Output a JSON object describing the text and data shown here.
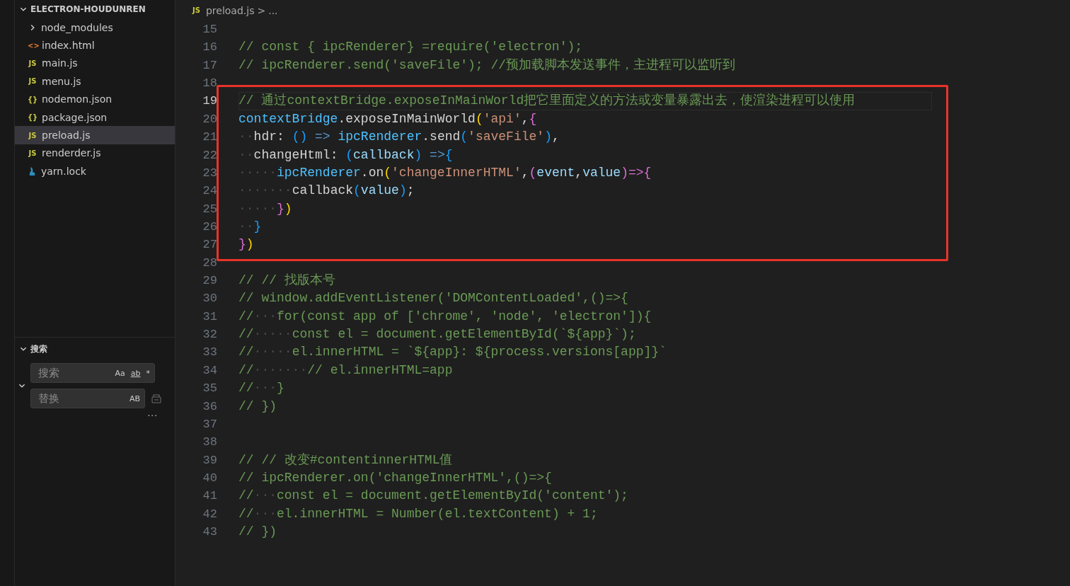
{
  "explorer": {
    "root": {
      "label": "ELECTRON-HOUDUNREN",
      "expanded": true
    },
    "items": [
      {
        "kind": "folder",
        "name": "node_modules",
        "selected": false
      },
      {
        "kind": "html",
        "icon": "<>",
        "name": "index.html",
        "selected": false
      },
      {
        "kind": "js",
        "icon": "JS",
        "name": "main.js",
        "selected": false
      },
      {
        "kind": "js",
        "icon": "JS",
        "name": "menu.js",
        "selected": false
      },
      {
        "kind": "json",
        "icon": "{}",
        "name": "nodemon.json",
        "selected": false
      },
      {
        "kind": "json",
        "icon": "{}",
        "name": "package.json",
        "selected": false
      },
      {
        "kind": "js",
        "icon": "JS",
        "name": "preload.js",
        "selected": true
      },
      {
        "kind": "js",
        "icon": "JS",
        "name": "renderder.js",
        "selected": false
      },
      {
        "kind": "yarn",
        "name": "yarn.lock",
        "selected": false
      }
    ]
  },
  "search": {
    "title": "搜索",
    "expanded": true,
    "replace_expanded": true,
    "find": {
      "placeholder": "搜索",
      "options": [
        "Aa",
        "ab",
        "*"
      ]
    },
    "replace": {
      "placeholder": "替换",
      "options": [
        "AB"
      ]
    },
    "more": "···"
  },
  "breadcrumb": {
    "icon": "JS",
    "file": "preload.js",
    "separator": ">",
    "rest": "..."
  },
  "code": {
    "blocks": [
      {
        "boxed": false,
        "lines": [
          {
            "number": "15",
            "current": false
          },
          {
            "number": "16",
            "current": false,
            "tokens": [
              {
                "kind": "comment",
                "text": "// const { ipcRenderer} =require('electron');"
              }
            ]
          },
          {
            "number": "17",
            "current": false,
            "tokens": [
              {
                "kind": "comment",
                "text": "// ipcRenderer.send('saveFile'); //预加载脚本发送事件，主进程可以监听到"
              }
            ]
          },
          {
            "number": "18",
            "current": false
          }
        ]
      },
      {
        "boxed": true,
        "lines": [
          {
            "number": "19",
            "current": true,
            "tokens": [
              {
                "kind": "comment",
                "text": "// 通过contextBridge.exposeInMainWorld把它里面定义的方法或变量暴露出去，使渲染进程可以使用"
              }
            ]
          },
          {
            "number": "20",
            "current": false,
            "tokens": [
              {
                "kind": "global",
                "text": "contextBridge"
              },
              {
                "kind": "plain",
                "text": ".exposeInMainWorld"
              },
              {
                "kind": "bracket1",
                "text": "("
              },
              {
                "kind": "string",
                "text": "'api'"
              },
              {
                "kind": "plain",
                "text": ","
              },
              {
                "kind": "bracket2",
                "text": "{"
              }
            ]
          },
          {
            "number": "21",
            "current": false,
            "tokens": [
              {
                "kind": "whitespace",
                "text": "··"
              },
              {
                "kind": "plain",
                "text": "hdr: "
              },
              {
                "kind": "bracket3",
                "text": "()"
              },
              {
                "kind": "keyword",
                "text": " => "
              },
              {
                "kind": "global",
                "text": "ipcRenderer"
              },
              {
                "kind": "plain",
                "text": ".send"
              },
              {
                "kind": "bracket3",
                "text": "("
              },
              {
                "kind": "string",
                "text": "'saveFile'"
              },
              {
                "kind": "bracket3",
                "text": ")"
              },
              {
                "kind": "plain",
                "text": ","
              }
            ]
          },
          {
            "number": "22",
            "current": false,
            "tokens": [
              {
                "kind": "whitespace",
                "text": "··"
              },
              {
                "kind": "plain",
                "text": "changeHtml: "
              },
              {
                "kind": "bracket3",
                "text": "("
              },
              {
                "kind": "variable",
                "text": "callback"
              },
              {
                "kind": "bracket3",
                "text": ")"
              },
              {
                "kind": "keyword",
                "text": " =>"
              },
              {
                "kind": "bracket3",
                "text": "{"
              }
            ]
          },
          {
            "number": "23",
            "current": false,
            "tokens": [
              {
                "kind": "whitespace",
                "text": "·····"
              },
              {
                "kind": "global",
                "text": "ipcRenderer"
              },
              {
                "kind": "plain",
                "text": ".on"
              },
              {
                "kind": "bracket1",
                "text": "("
              },
              {
                "kind": "string",
                "text": "'changeInnerHTML'"
              },
              {
                "kind": "plain",
                "text": ","
              },
              {
                "kind": "bracket2",
                "text": "("
              },
              {
                "kind": "variable",
                "text": "event"
              },
              {
                "kind": "plain",
                "text": ","
              },
              {
                "kind": "variable",
                "text": "value"
              },
              {
                "kind": "bracket2",
                "text": ")"
              },
              {
                "kind": "bracket2",
                "text": "=>{"
              }
            ]
          },
          {
            "number": "24",
            "current": false,
            "tokens": [
              {
                "kind": "whitespace",
                "text": "·······"
              },
              {
                "kind": "plain",
                "text": "callback"
              },
              {
                "kind": "bracket3",
                "text": "("
              },
              {
                "kind": "variable",
                "text": "value"
              },
              {
                "kind": "bracket3",
                "text": ")"
              },
              {
                "kind": "plain",
                "text": ";"
              }
            ]
          },
          {
            "number": "25",
            "current": false,
            "tokens": [
              {
                "kind": "whitespace",
                "text": "·····"
              },
              {
                "kind": "bracket2",
                "text": "}"
              },
              {
                "kind": "bracket1",
                "text": ")"
              }
            ]
          },
          {
            "number": "26",
            "current": false,
            "tokens": [
              {
                "kind": "whitespace",
                "text": "··"
              },
              {
                "kind": "bracket3",
                "text": "}"
              }
            ]
          },
          {
            "number": "27",
            "current": false,
            "tokens": [
              {
                "kind": "bracket2",
                "text": "}"
              },
              {
                "kind": "bracket1",
                "text": ")"
              }
            ]
          }
        ]
      },
      {
        "boxed": false,
        "lines": [
          {
            "number": "28",
            "current": false
          },
          {
            "number": "29",
            "current": false,
            "tokens": [
              {
                "kind": "comment",
                "text": "// // 找版本号"
              }
            ]
          },
          {
            "number": "30",
            "current": false,
            "tokens": [
              {
                "kind": "comment",
                "text": "// window.addEventListener('DOMContentLoaded',()=>{"
              }
            ]
          },
          {
            "number": "31",
            "current": false,
            "tokens": [
              {
                "kind": "comment",
                "text": "//"
              },
              {
                "kind": "whitespace",
                "text": "···"
              },
              {
                "kind": "comment",
                "text": "for(const app of ['chrome', 'node', 'electron']){"
              }
            ]
          },
          {
            "number": "32",
            "current": false,
            "tokens": [
              {
                "kind": "comment",
                "text": "//"
              },
              {
                "kind": "whitespace",
                "text": "·····"
              },
              {
                "kind": "comment",
                "text": "const el = document.getElementById(`${app}`);"
              }
            ]
          },
          {
            "number": "33",
            "current": false,
            "tokens": [
              {
                "kind": "comment",
                "text": "//"
              },
              {
                "kind": "whitespace",
                "text": "·····"
              },
              {
                "kind": "comment",
                "text": "el.innerHTML = `${app}: ${process.versions[app]}`"
              }
            ]
          },
          {
            "number": "34",
            "current": false,
            "tokens": [
              {
                "kind": "comment",
                "text": "//"
              },
              {
                "kind": "whitespace",
                "text": "·······"
              },
              {
                "kind": "comment",
                "text": "// el.innerHTML=app"
              }
            ]
          },
          {
            "number": "35",
            "current": false,
            "tokens": [
              {
                "kind": "comment",
                "text": "//"
              },
              {
                "kind": "whitespace",
                "text": "···"
              },
              {
                "kind": "comment",
                "text": "}"
              }
            ]
          },
          {
            "number": "36",
            "current": false,
            "tokens": [
              {
                "kind": "comment",
                "text": "// })"
              }
            ]
          },
          {
            "number": "37",
            "current": false
          },
          {
            "number": "38",
            "current": false
          },
          {
            "number": "39",
            "current": false,
            "tokens": [
              {
                "kind": "comment",
                "text": "// // 改变#contentinnerHTML值"
              }
            ]
          },
          {
            "number": "40",
            "current": false,
            "tokens": [
              {
                "kind": "comment",
                "text": "// ipcRenderer.on('changeInnerHTML',()=>{"
              }
            ]
          },
          {
            "number": "41",
            "current": false,
            "tokens": [
              {
                "kind": "comment",
                "text": "//"
              },
              {
                "kind": "whitespace",
                "text": "···"
              },
              {
                "kind": "comment",
                "text": "const el = document.getElementById('content');"
              }
            ]
          },
          {
            "number": "42",
            "current": false,
            "tokens": [
              {
                "kind": "comment",
                "text": "//"
              },
              {
                "kind": "whitespace",
                "text": "···"
              },
              {
                "kind": "comment",
                "text": "el.innerHTML = Number(el.textContent) + 1;"
              }
            ]
          },
          {
            "number": "43",
            "current": false,
            "tokens": [
              {
                "kind": "comment",
                "text": "// })"
              }
            ]
          }
        ]
      }
    ]
  }
}
